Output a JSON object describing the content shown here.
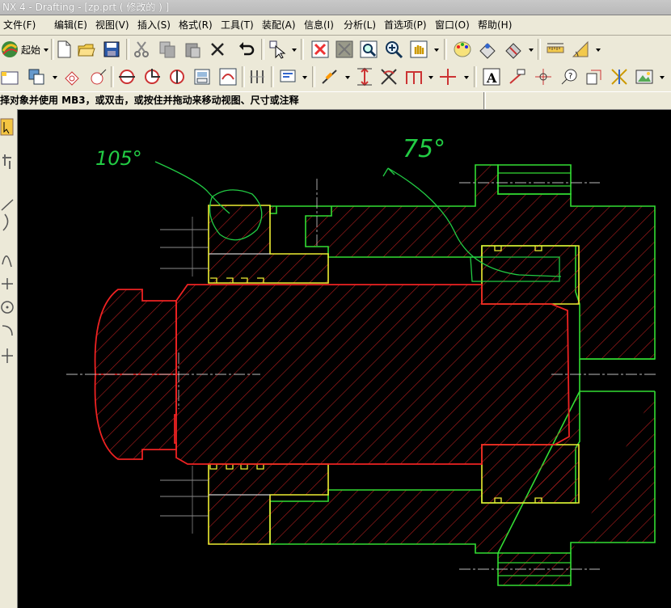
{
  "window": {
    "title": "NX 4 - Drafting - [zp.prt ( 修改的 ) ]"
  },
  "menu": [
    {
      "label": "文件(F)"
    },
    {
      "label": "编辑(E)"
    },
    {
      "label": "视图(V)"
    },
    {
      "label": "插入(S)"
    },
    {
      "label": "格式(R)"
    },
    {
      "label": "工具(T)"
    },
    {
      "label": "装配(A)"
    },
    {
      "label": "信息(I)"
    },
    {
      "label": "分析(L)"
    },
    {
      "label": "首选项(P)"
    },
    {
      "label": "窗口(O)"
    },
    {
      "label": "帮助(H)"
    }
  ],
  "toolbar": {
    "start_label": "起始"
  },
  "status": {
    "cue_line": "择对象并使用 MB3，或双击，或按住并拖动来移动视图、尺寸或注释"
  },
  "annotations": {
    "angle_left": "105°",
    "angle_right": "75°"
  },
  "colors": {
    "canvas_bg": "#000000",
    "green_part": "#33dd33",
    "red_part": "#ee2222",
    "yellow_part": "#eeee33",
    "hatch": "#cc2222",
    "handwriting": "#22cc44",
    "centerline": "#bbbbbb"
  }
}
